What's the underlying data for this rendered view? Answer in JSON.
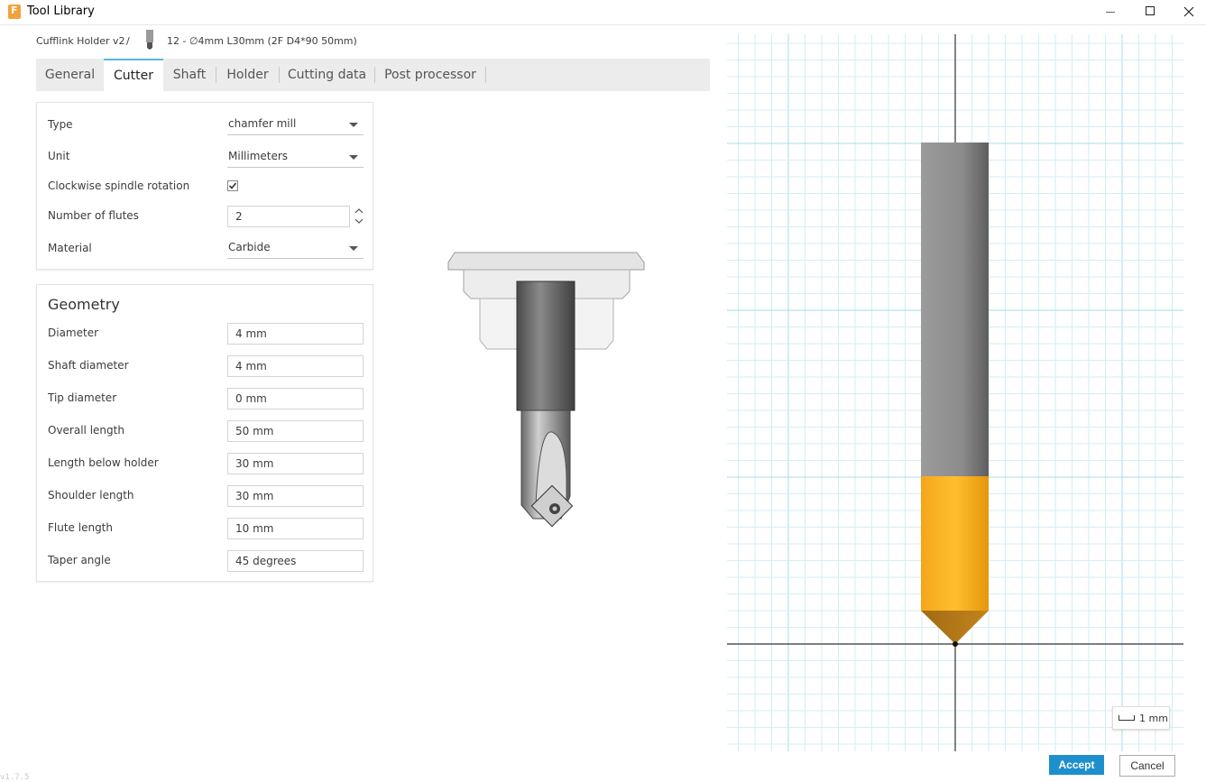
{
  "window": {
    "title": "Tool Library",
    "icon": "fusion-app-icon",
    "icon_letter": "F"
  },
  "breadcrumb": {
    "root": "Cufflink Holder v2",
    "separator": "/",
    "tool_icon": "endmill-icon",
    "tool": "12 - ∅4mm L30mm (2F D4*90 50mm)"
  },
  "tabs": [
    {
      "label": "General",
      "active": false
    },
    {
      "label": "Cutter",
      "active": true
    },
    {
      "label": "Shaft",
      "active": false
    },
    {
      "label": "Holder",
      "active": false
    },
    {
      "label": "Cutting data",
      "active": false
    },
    {
      "label": "Post processor",
      "active": false
    }
  ],
  "cutter": {
    "type": {
      "label": "Type",
      "value": "chamfer mill"
    },
    "unit": {
      "label": "Unit",
      "value": "Millimeters"
    },
    "spindle": {
      "label": "Clockwise spindle rotation",
      "checked": true
    },
    "flutes": {
      "label": "Number of flutes",
      "value": "2"
    },
    "material": {
      "label": "Material",
      "value": "Carbide"
    }
  },
  "geometry": {
    "title": "Geometry",
    "rows": [
      {
        "label": "Diameter",
        "value": "4 mm"
      },
      {
        "label": "Shaft diameter",
        "value": "4 mm"
      },
      {
        "label": "Tip diameter",
        "value": "0 mm"
      },
      {
        "label": "Overall length",
        "value": "50 mm"
      },
      {
        "label": "Length below holder",
        "value": "30 mm"
      },
      {
        "label": "Shoulder length",
        "value": "30 mm"
      },
      {
        "label": "Flute length",
        "value": "10 mm"
      },
      {
        "label": "Taper angle",
        "value": "45 degrees"
      }
    ]
  },
  "viewport": {
    "scale_label": "1 mm",
    "shaft_color": "#8f8f8f",
    "flute_color": "#f6ab19",
    "tip_color": "#b07516"
  },
  "buttons": {
    "accept": "Accept",
    "cancel": "Cancel"
  },
  "version": "v1.7.5",
  "colors": {
    "accent": "#1e8fcd",
    "tab_indicator": "#58b6e7"
  }
}
